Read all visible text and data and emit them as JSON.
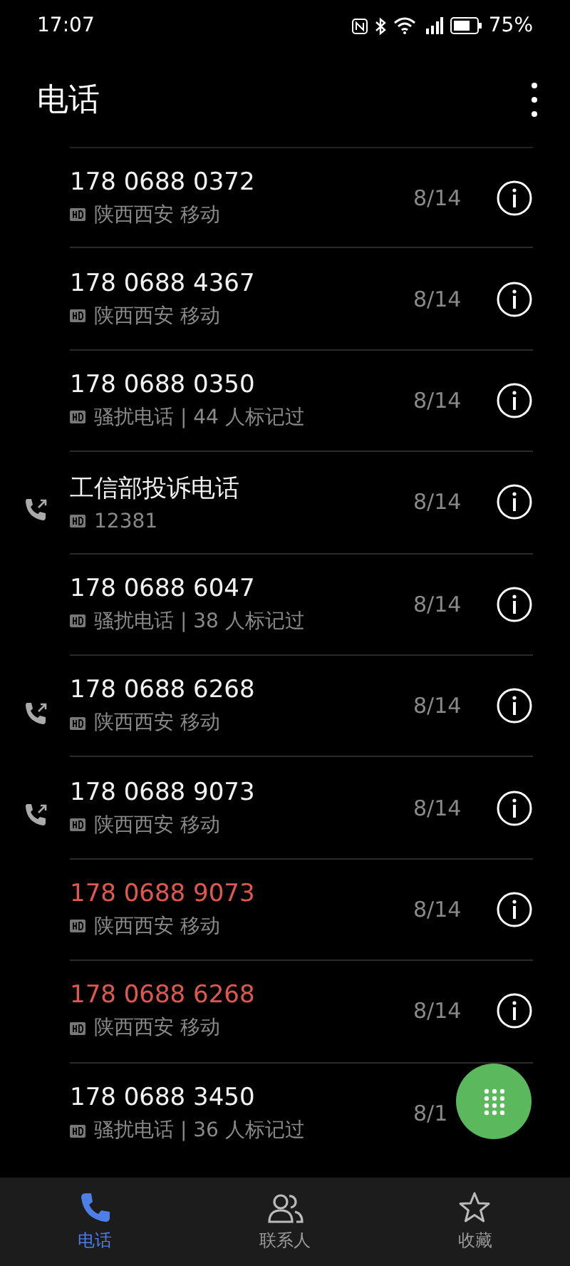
{
  "status_bar": {
    "time": "17:07",
    "battery": "75%"
  },
  "header": {
    "title": "电话"
  },
  "calls": [
    {
      "name": "178 0688 0372",
      "detail": "陕西西安 移动",
      "date": "8/14",
      "outgoing": false,
      "missed": false,
      "info_button": true
    },
    {
      "name": "178 0688 4367",
      "detail": "陕西西安 移动",
      "date": "8/14",
      "outgoing": false,
      "missed": false,
      "info_button": true
    },
    {
      "name": "178 0688 0350",
      "detail": "骚扰电话 | 44 人标记过",
      "date": "8/14",
      "outgoing": false,
      "missed": false,
      "info_button": true
    },
    {
      "name": "工信部投诉电话",
      "detail": "12381",
      "date": "8/14",
      "outgoing": true,
      "missed": false,
      "info_button": true
    },
    {
      "name": "178 0688 6047",
      "detail": "骚扰电话 | 38 人标记过",
      "date": "8/14",
      "outgoing": false,
      "missed": false,
      "info_button": true
    },
    {
      "name": "178 0688 6268",
      "detail": "陕西西安 移动",
      "date": "8/14",
      "outgoing": true,
      "missed": false,
      "info_button": true
    },
    {
      "name": "178 0688 9073",
      "detail": "陕西西安 移动",
      "date": "8/14",
      "outgoing": true,
      "missed": false,
      "info_button": true
    },
    {
      "name": "178 0688 9073",
      "detail": "陕西西安 移动",
      "date": "8/14",
      "outgoing": false,
      "missed": true,
      "info_button": true
    },
    {
      "name": "178 0688 6268",
      "detail": "陕西西安 移动",
      "date": "8/14",
      "outgoing": false,
      "missed": true,
      "info_button": true
    },
    {
      "name": "178 0688 3450",
      "detail": "骚扰电话 | 36 人标记过",
      "date": "8/1",
      "outgoing": false,
      "missed": false,
      "info_button": false
    }
  ],
  "tabs": [
    {
      "label": "电话",
      "selected": true
    },
    {
      "label": "联系人",
      "selected": false
    },
    {
      "label": "收藏",
      "selected": false
    }
  ]
}
